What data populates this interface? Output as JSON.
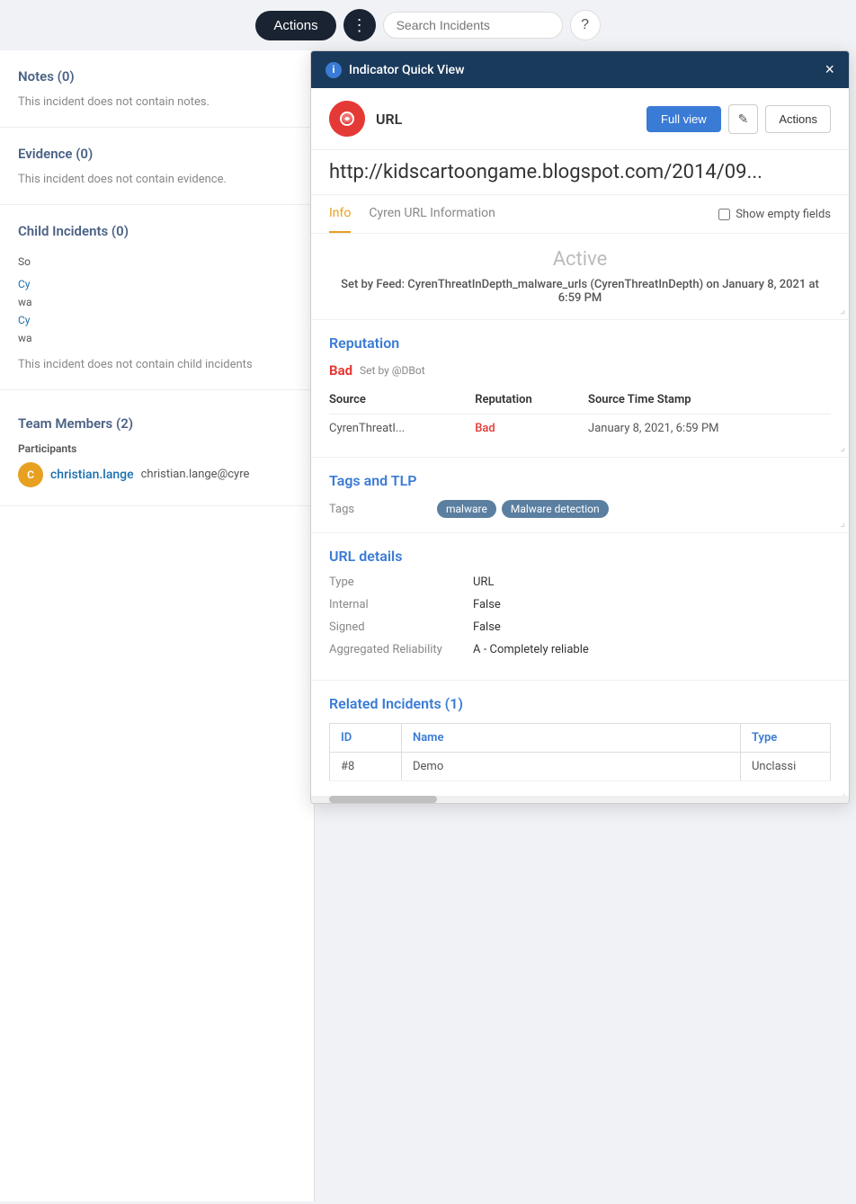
{
  "topbar": {
    "actions_label": "Actions",
    "three_dots": "⋮",
    "search_placeholder": "Search Incidents",
    "help_label": "?"
  },
  "left_panel": {
    "notes": {
      "title": "Notes (0)",
      "empty_text": "This incident does not contain notes."
    },
    "evidence": {
      "title": "Evidence (0)",
      "empty_text": "This incident does not contain evidence."
    },
    "child_incidents": {
      "title": "Child Incidents (0)",
      "empty_text": "This incident does not contain child incidents"
    },
    "side_items": [
      {
        "label": "So"
      },
      {
        "label": "Cy"
      },
      {
        "label": "wa"
      },
      {
        "label": "Cy"
      },
      {
        "label": "wa"
      }
    ],
    "team_members": {
      "title": "Team Members (2)",
      "participants_label": "Participants",
      "members": [
        {
          "avatar_initials": "C",
          "name": "christian.lange",
          "email": "christian.lange@cyre"
        }
      ]
    }
  },
  "quick_view": {
    "header_title": "Indicator Quick View",
    "close_label": "×",
    "type_label": "URL",
    "full_view_label": "Full view",
    "edit_icon": "✎",
    "actions_label": "Actions",
    "url_text": "http://kidscartoongame.blogspot.com/2014/09...",
    "tabs": [
      {
        "label": "Info",
        "active": true
      },
      {
        "label": "Cyren URL Information",
        "active": false
      }
    ],
    "show_empty_fields_label": "Show empty fields",
    "status": {
      "label": "Active",
      "set_by_text": "Set by Feed: CyrenThreatInDepth_malware_urls (CyrenThreatInDepth) on January 8, 2021 at 6:59 PM"
    },
    "reputation": {
      "section_title": "Reputation",
      "bad_label": "Bad",
      "set_by": "Set by @DBot",
      "table_headers": [
        "Source",
        "Reputation",
        "Source Time Stamp"
      ],
      "rows": [
        {
          "source": "CyrenThreatI...",
          "reputation": "Bad",
          "timestamp": "January 8, 2021, 6:59 PM"
        }
      ]
    },
    "tags_and_tlp": {
      "section_title": "Tags and TLP",
      "tags_label": "Tags",
      "tags": [
        "malware",
        "Malware detection"
      ]
    },
    "url_details": {
      "section_title": "URL details",
      "fields": [
        {
          "label": "Type",
          "value": "URL"
        },
        {
          "label": "Internal",
          "value": "False"
        },
        {
          "label": "Signed",
          "value": "False"
        },
        {
          "label": "Aggregated Reliability",
          "value": "A - Completely reliable"
        }
      ]
    },
    "related_incidents": {
      "section_title": "Related Incidents (1)",
      "headers": [
        "ID",
        "Name",
        "Type"
      ],
      "rows": [
        {
          "id": "#8",
          "name": "Demo",
          "type": "Unclassi"
        }
      ]
    }
  }
}
